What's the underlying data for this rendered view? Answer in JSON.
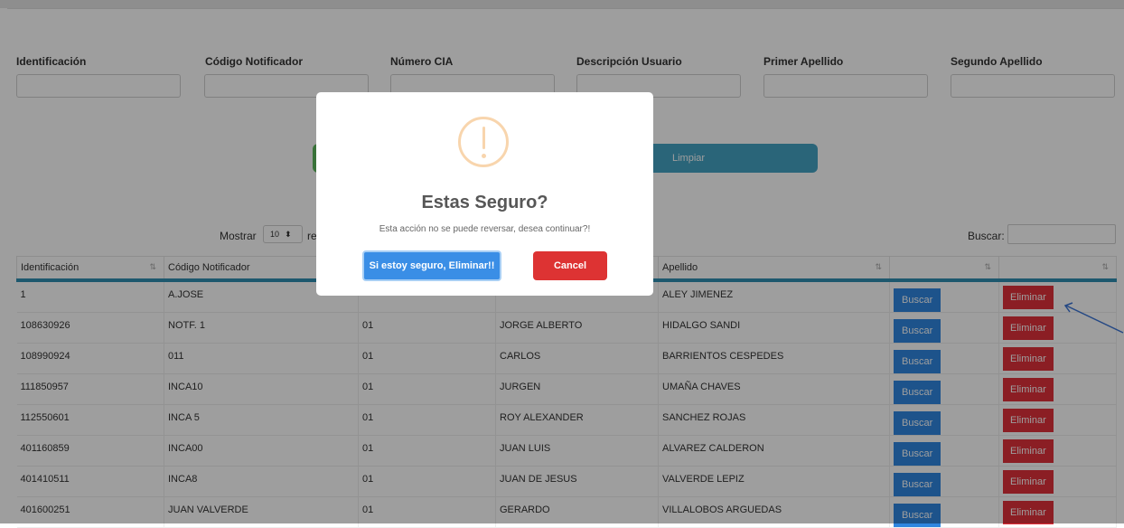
{
  "filters": {
    "labels": [
      "Identificación",
      "Código Notificador",
      "Número CIA",
      "Descripción Usuario",
      "Primer Apellido",
      "Segundo Apellido"
    ]
  },
  "actions": {
    "limpiar_label": "Limpiar"
  },
  "table_controls": {
    "mostrar_label": "Mostrar",
    "page_size": "10",
    "after_select_text": "re",
    "buscar_label": "Buscar:"
  },
  "table": {
    "headers": [
      "Identificación",
      "Código Notificador",
      "",
      "",
      "Apellido",
      "",
      ""
    ],
    "rows": [
      {
        "id": "1",
        "codigo": "A.JOSE",
        "cia": "",
        "nombre": "",
        "apellido": "ALEY JIMENEZ"
      },
      {
        "id": "108630926",
        "codigo": "NOTF. 1",
        "cia": "01",
        "nombre": "JORGE ALBERTO",
        "apellido": "HIDALGO SANDI"
      },
      {
        "id": "108990924",
        "codigo": "011",
        "cia": "01",
        "nombre": "CARLOS",
        "apellido": "BARRIENTOS CESPEDES"
      },
      {
        "id": "111850957",
        "codigo": "INCA10",
        "cia": "01",
        "nombre": "JURGEN",
        "apellido": "UMAÑA CHAVES"
      },
      {
        "id": "112550601",
        "codigo": "INCA 5",
        "cia": "01",
        "nombre": "ROY ALEXANDER",
        "apellido": "SANCHEZ ROJAS"
      },
      {
        "id": "401160859",
        "codigo": "INCA00",
        "cia": "01",
        "nombre": "JUAN LUIS",
        "apellido": "ALVAREZ CALDERON"
      },
      {
        "id": "401410511",
        "codigo": "INCA8",
        "cia": "01",
        "nombre": "JUAN DE JESUS",
        "apellido": "VALVERDE LEPIZ"
      },
      {
        "id": "401600251",
        "codigo": "JUAN VALVERDE",
        "cia": "01",
        "nombre": "GERARDO",
        "apellido": "VILLALOBOS ARGUEDAS"
      }
    ],
    "buscar_btn": "Buscar",
    "eliminar_btn": "Eliminar"
  },
  "modal": {
    "icon": "warning-icon",
    "title": "Estas Seguro?",
    "text": "Esta acción no se puede reversar, desea continuar?!",
    "confirm_label": "Si estoy seguro, Eliminar!!",
    "cancel_label": "Cancel"
  },
  "colors": {
    "primary": "#2f86e0",
    "danger": "#e0313b",
    "info": "#45a4c4",
    "header_accent": "#2f8fb2",
    "warning_icon": "#f8d5ad",
    "annotation_arrow": "#3b74d6"
  }
}
